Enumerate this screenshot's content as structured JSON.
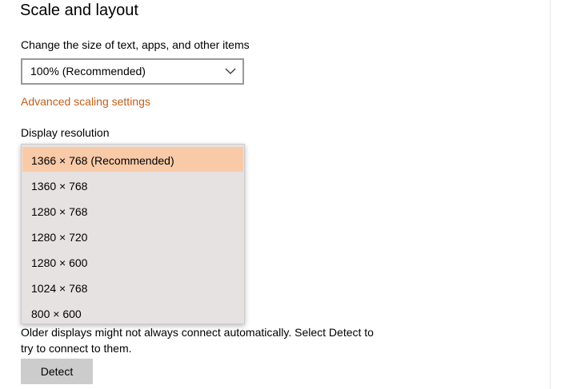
{
  "section": {
    "title": "Scale and layout"
  },
  "scale": {
    "label": "Change the size of text, apps, and other items",
    "selected_value": "100% (Recommended)"
  },
  "advanced_link": "Advanced scaling settings",
  "resolution": {
    "label": "Display resolution",
    "options": [
      "1366 × 768 (Recommended)",
      "1360 × 768",
      "1280 × 768",
      "1280 × 720",
      "1280 × 600",
      "1024 × 768",
      "800 × 600"
    ],
    "selected_index": 0
  },
  "detect": {
    "note": "Older displays might not always connect automatically. Select Detect to try to connect to them.",
    "button_label": "Detect"
  },
  "colors": {
    "accent_link": "#c25e1a",
    "selected_highlight": "#f9caa8",
    "dropdown_background": "#e6e2e2",
    "button_background": "#cccccc"
  },
  "icons": {
    "dropdown_chevron": "chevron-down-icon"
  }
}
